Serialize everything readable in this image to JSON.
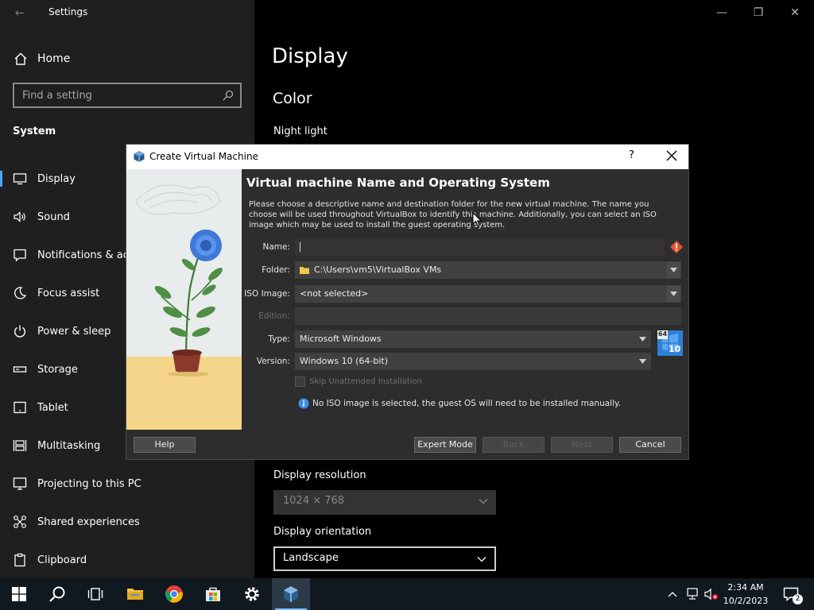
{
  "settings": {
    "window_title": "Settings",
    "home_label": "Home",
    "search_placeholder": "Find a setting",
    "group_label": "System",
    "nav_items": [
      {
        "label": "Display",
        "icon": "monitor-icon"
      },
      {
        "label": "Sound",
        "icon": "speaker-icon"
      },
      {
        "label": "Notifications & ac",
        "icon": "notification-icon"
      },
      {
        "label": "Focus assist",
        "icon": "moon-icon"
      },
      {
        "label": "Power & sleep",
        "icon": "power-icon"
      },
      {
        "label": "Storage",
        "icon": "storage-icon"
      },
      {
        "label": "Tablet",
        "icon": "tablet-icon"
      },
      {
        "label": "Multitasking",
        "icon": "multitasking-icon"
      },
      {
        "label": "Projecting to this PC",
        "icon": "projector-icon"
      },
      {
        "label": "Shared experiences",
        "icon": "shared-icon"
      },
      {
        "label": "Clipboard",
        "icon": "clipboard-icon"
      }
    ],
    "page_title": "Display",
    "section_title": "Color",
    "night_light_label": "Night light",
    "resolution_label": "Display resolution",
    "resolution_value": "1024 × 768",
    "orientation_label": "Display orientation",
    "orientation_value": "Landscape"
  },
  "dialog": {
    "title": "Create Virtual Machine",
    "help_symbol": "?",
    "heading": "Virtual machine Name and Operating System",
    "description": "Please choose a descriptive name and destination folder for the new virtual machine. The name you choose will be used throughout VirtualBox to identify this machine. Additionally, you can select an ISO image which may be used to install the guest operating system.",
    "fields": {
      "name_label": "Name:",
      "name_value": "",
      "folder_label": "Folder:",
      "folder_value": "C:\\Users\\vm5\\VirtualBox VMs",
      "iso_label": "ISO Image:",
      "iso_value": "<not selected>",
      "edition_label": "Edition:",
      "edition_value": "",
      "type_label": "Type:",
      "type_value": "Microsoft Windows",
      "version_label": "Version:",
      "version_value": "Windows 10 (64-bit)",
      "os_badge_top": "64",
      "os_badge_num": "10"
    },
    "skip_unattended_label": "Skip Unattended Installation",
    "info_message": "No ISO image is selected, the guest OS will need to be installed manually.",
    "buttons": {
      "help": "Help",
      "expert": "Expert Mode",
      "back": "Back",
      "next": "Next",
      "cancel": "Cancel"
    }
  },
  "taskbar": {
    "clock_time": "2:34 AM",
    "clock_date": "10/2/2023",
    "notification_count": "2"
  },
  "colors": {
    "accent": "#4ba3ff",
    "sidebar_bg": "#1f1f1f",
    "dialog_bg": "#2d2d2d",
    "warning": "#e8522f"
  }
}
